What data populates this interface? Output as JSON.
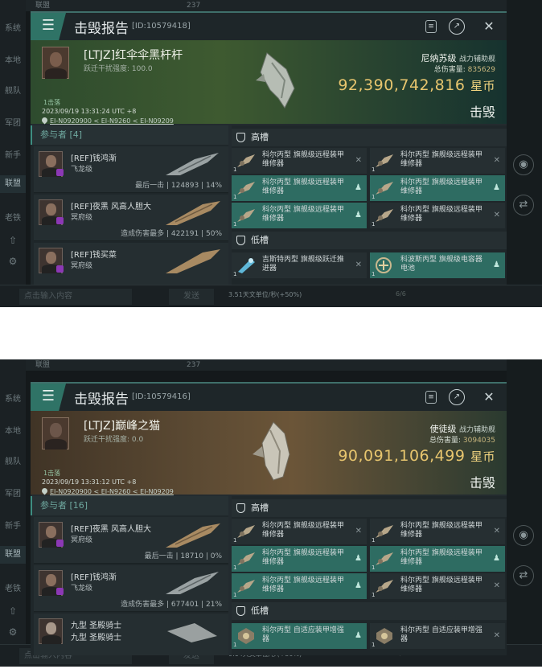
{
  "screens": [
    {
      "bg": {
        "channels": [
          "系统",
          "本地",
          "舰队",
          "军团",
          "新手",
          "联盟",
          "老铁"
        ],
        "top_channel": "联盟",
        "top_count": "237",
        "input_placeholder": "点击输入内容",
        "send": "发送",
        "rate": "3.51天文单位/秒(+50%)",
        "bottom_num": "6/6"
      },
      "header": {
        "title": "击毁报告",
        "id": "[ID:10579418]"
      },
      "victim": {
        "name": "[LTJZ]红伞伞黑杆杆",
        "warp_label": "跃迁干扰强度: 100.0",
        "tag": "1击落",
        "time": "2023/09/19 13:31:24 UTC +8",
        "location": "EI-N0920900 < EI-N9260 < EI-N09209",
        "ship_class": "尼纳苏级",
        "ship_role": "战力辅助舰",
        "total_damage_label": "总伤害量:",
        "total_damage": "835629",
        "isk_value": "92,390,742,816",
        "isk_unit": "星币",
        "result": "击毁"
      },
      "participants": {
        "header": "参与者 [4]",
        "rows": [
          {
            "name": "[REF]钱鸿渐",
            "ship": "飞龙级",
            "stat": "最后一击 | 124893 | 14%"
          },
          {
            "name": "[REF]夜黑 风高人胆大",
            "ship": "冥府级",
            "stat": "造成伤害最多 | 422191 | 50%"
          },
          {
            "name": "[REF]钱买菜",
            "ship": "冥府级",
            "stat": ""
          }
        ]
      },
      "slots": {
        "high_title": "高槽",
        "low_title": "低槽",
        "high": [
          {
            "name": "科尔丙型 旗舰级远程装甲维修器",
            "hl": false
          },
          {
            "name": "科尔丙型 旗舰级远程装甲维修器",
            "hl": false
          },
          {
            "name": "科尔丙型 旗舰级远程装甲维修器",
            "hl": true
          },
          {
            "name": "科尔丙型 旗舰级远程装甲维修器",
            "hl": true
          },
          {
            "name": "科尔丙型 旗舰级远程装甲维修器",
            "hl": true
          },
          {
            "name": "科尔丙型 旗舰级远程装甲维修器",
            "hl": false
          }
        ],
        "low": [
          {
            "name": "吉斯特丙型 旗舰级跃迁推进器",
            "hl": false
          },
          {
            "name": "科波斯丙型 旗舰级电容器电池",
            "hl": true
          }
        ]
      }
    },
    {
      "bg": {
        "channels": [
          "系统",
          "本地",
          "舰队",
          "军团",
          "新手",
          "联盟",
          "老铁"
        ],
        "top_channel": "联盟",
        "top_count": "237",
        "input_placeholder": "点击输入内容",
        "send": "发送",
        "rate": "0.14天文单位/秒(+50%)",
        "bottom_num": "6/6"
      },
      "header": {
        "title": "击毁报告",
        "id": "[ID:10579416]"
      },
      "victim": {
        "name": "[LTJZ]巅峰之猫",
        "warp_label": "跃迁干扰强度: 0.0",
        "tag": "1击落",
        "time": "2023/09/19 13:31:12 UTC +8",
        "location": "EI-N0920900 < EI-N9260 < EI-N09209",
        "ship_class": "使徒级",
        "ship_role": "战力辅助舰",
        "total_damage_label": "总伤害量:",
        "total_damage": "3094035",
        "isk_value": "90,091,106,499",
        "isk_unit": "星币",
        "result": "击毁"
      },
      "participants": {
        "header": "参与者 [16]",
        "rows": [
          {
            "name": "[REF]夜黑 风高人胆大",
            "ship": "冥府级",
            "stat": "最后一击 | 18710 | 0%"
          },
          {
            "name": "[REF]钱鸿渐",
            "ship": "飞龙级",
            "stat": "造成伤害最多 | 677401 | 21%"
          },
          {
            "name": "九型 圣殿骑士",
            "ship": "九型 圣殿骑士",
            "stat": ""
          }
        ]
      },
      "slots": {
        "high_title": "高槽",
        "low_title": "低槽",
        "high": [
          {
            "name": "科尔丙型 旗舰级远程装甲维修器",
            "hl": false
          },
          {
            "name": "科尔丙型 旗舰级远程装甲维修器",
            "hl": false
          },
          {
            "name": "科尔丙型 旗舰级远程装甲维修器",
            "hl": true
          },
          {
            "name": "科尔丙型 旗舰级远程装甲维修器",
            "hl": true
          },
          {
            "name": "科尔丙型 旗舰级远程装甲维修器",
            "hl": true
          },
          {
            "name": "科尔丙型 旗舰级远程装甲维修器",
            "hl": false
          }
        ],
        "low": [
          {
            "name": "科尔丙型 自适应装甲增强器",
            "hl": true
          },
          {
            "name": "科尔丙型 自适应装甲增强器",
            "hl": false
          }
        ]
      }
    }
  ]
}
